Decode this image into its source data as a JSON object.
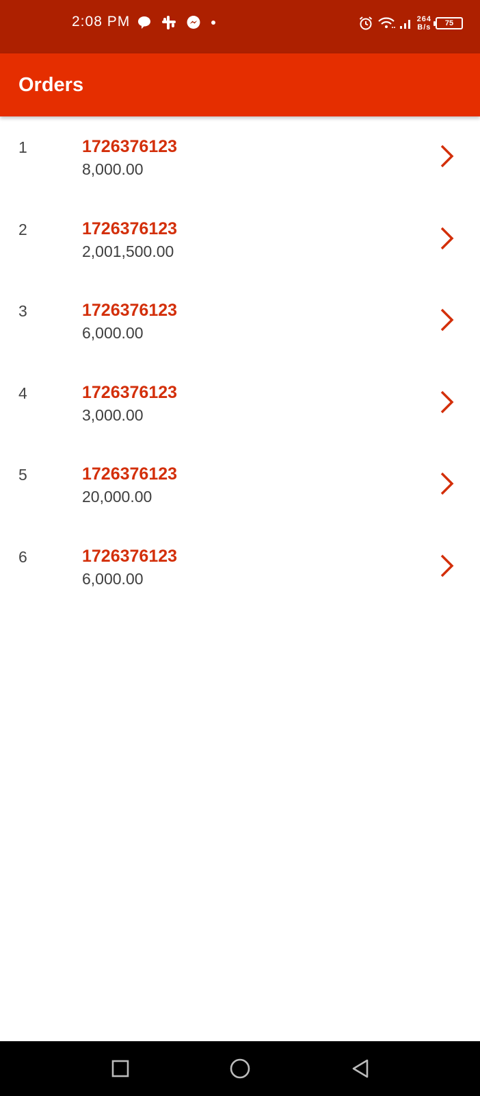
{
  "status_bar": {
    "time": "2:08 PM",
    "net_speed_value": "264",
    "net_speed_unit": "B/s",
    "battery_level": "75",
    "icons": [
      "chat-bubble-icon",
      "slack-icon",
      "messenger-icon",
      "dot-icon",
      "alarm-icon",
      "wifi-icon",
      "signal-icon",
      "battery-icon"
    ]
  },
  "app_bar": {
    "title": "Orders"
  },
  "orders": [
    {
      "index": "1",
      "id": "1726376123",
      "amount": "8,000.00"
    },
    {
      "index": "2",
      "id": "1726376123",
      "amount": "2,001,500.00"
    },
    {
      "index": "3",
      "id": "1726376123",
      "amount": "6,000.00"
    },
    {
      "index": "4",
      "id": "1726376123",
      "amount": "3,000.00"
    },
    {
      "index": "5",
      "id": "1726376123",
      "amount": "20,000.00"
    },
    {
      "index": "6",
      "id": "1726376123",
      "amount": "6,000.00"
    }
  ],
  "nav_bar": {
    "buttons": [
      "recents-square-icon",
      "home-circle-icon",
      "back-triangle-icon"
    ]
  },
  "colors": {
    "status_bar": "#ad2000",
    "app_bar": "#e52e00",
    "accent": "#d32f0a",
    "amount_text": "#3f3f3f",
    "nav_bar": "#000000"
  }
}
